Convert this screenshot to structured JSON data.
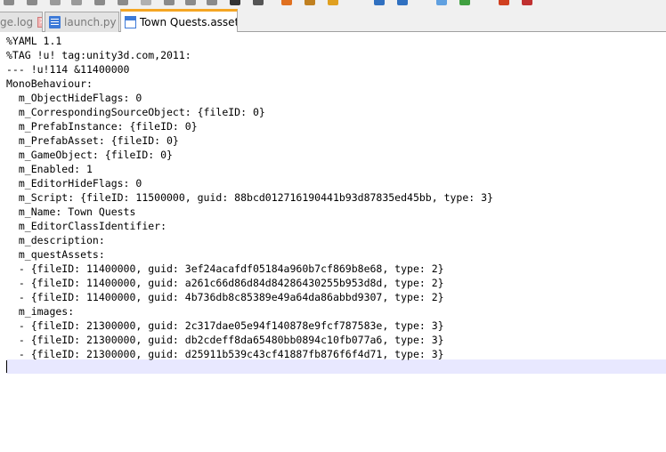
{
  "tabs": [
    {
      "label": "ge.log",
      "active": false
    },
    {
      "label": "launch.py",
      "active": false
    },
    {
      "label": "Town Quests.asset",
      "active": true
    }
  ],
  "editor": {
    "lines": [
      "%YAML 1.1",
      "%TAG !u! tag:unity3d.com,2011:",
      "--- !u!114 &11400000",
      "MonoBehaviour:",
      "  m_ObjectHideFlags: 0",
      "  m_CorrespondingSourceObject: {fileID: 0}",
      "  m_PrefabInstance: {fileID: 0}",
      "  m_PrefabAsset: {fileID: 0}",
      "  m_GameObject: {fileID: 0}",
      "  m_Enabled: 1",
      "  m_EditorHideFlags: 0",
      "  m_Script: {fileID: 11500000, guid: 88bcd012716190441b93d87835ed45bb, type: 3}",
      "  m_Name: Town Quests",
      "  m_EditorClassIdentifier:",
      "  m_description:",
      "  m_questAssets:",
      "  - {fileID: 11400000, guid: 3ef24acafdf05184a960b7cf869b8e68, type: 2}",
      "  - {fileID: 11400000, guid: a261c66d86d84d84286430255b953d8d, type: 2}",
      "  - {fileID: 11400000, guid: 4b736db8c85389e49a64da86abbd9307, type: 2}",
      "  m_images:",
      "  - {fileID: 21300000, guid: 2c317dae05e94f140878e9fcf787583e, type: 3}",
      "  - {fileID: 21300000, guid: db2cdeff8da65480bb0894c10fb077a6, type: 3}",
      "  - {fileID: 21300000, guid: d25911b539c43cf41887fb876f6f4d71, type: 3}"
    ]
  },
  "colors": {
    "active_tab_accent": "#f5a623",
    "close_active": "#d84040",
    "close_inactive": "#f3b8b8",
    "current_line": "#e8e8ff"
  },
  "toolbar_icons": [
    "new-icon",
    "open-icon",
    "save-icon",
    "save-all-icon",
    "close-icon",
    "print-icon",
    "cut-icon",
    "copy-icon",
    "paste-icon",
    "undo-icon",
    "redo-icon",
    "find-icon",
    "replace-icon",
    "zoom-in-icon",
    "zoom-out-icon",
    "sync-icon",
    "wrap-icon",
    "indent-guide-icon",
    "language-icon",
    "macro-icon",
    "record-icon"
  ]
}
